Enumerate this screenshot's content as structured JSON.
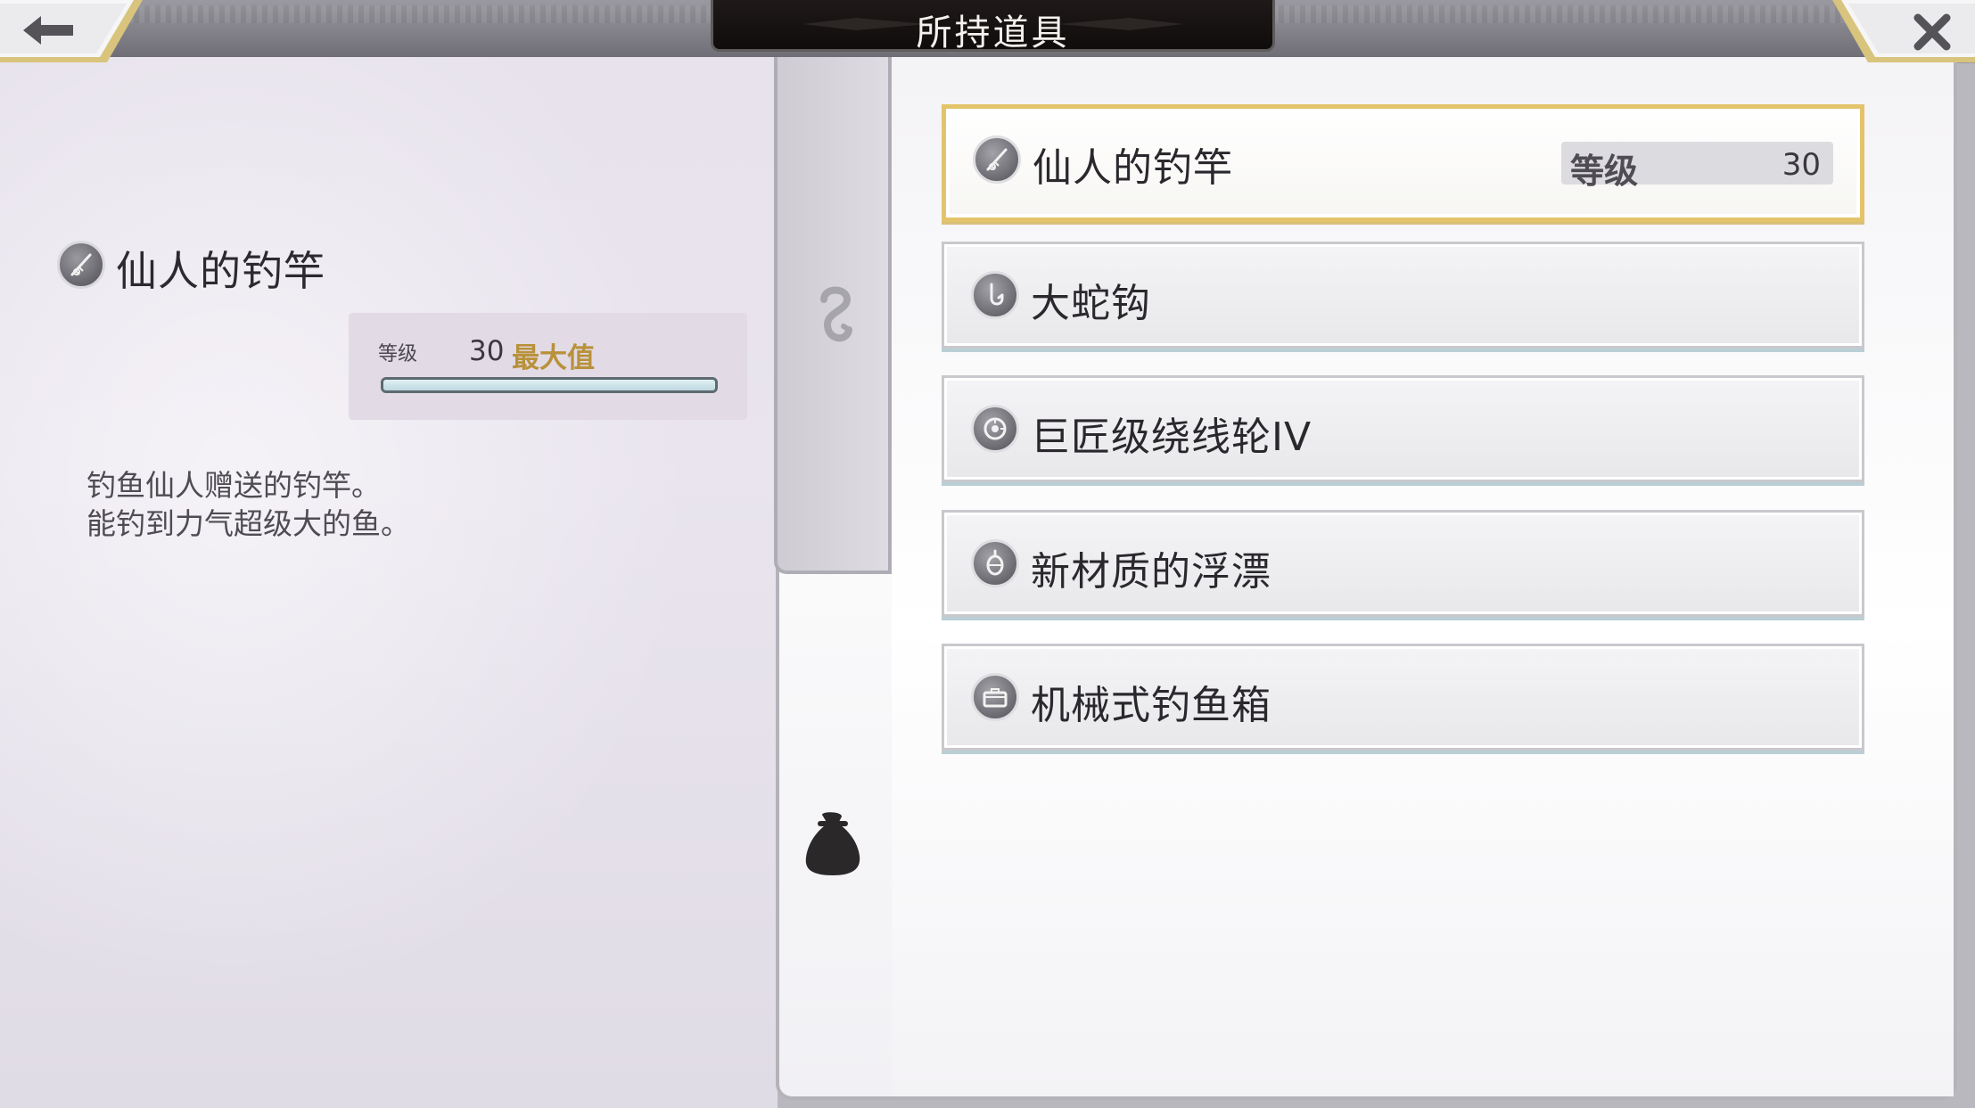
{
  "header": {
    "title": "所持道具",
    "back_icon": "back-arrow-icon",
    "close_icon": "close-icon"
  },
  "detail": {
    "icon": "fishing-rod-icon",
    "name": "仙人的钓竿",
    "level_label": "等级",
    "level_value": "30",
    "level_max_label": "最大值",
    "level_progress": 1.0,
    "description_lines": [
      "钓鱼仙人赠送的钓竿。",
      "能钓到力气超级大的鱼。"
    ]
  },
  "tabs": {
    "tackle_icon": "hook-icon",
    "items_icon": "bag-icon"
  },
  "items": [
    {
      "name": "仙人的钓竿",
      "icon": "fishing-rod-icon",
      "selected": true,
      "level_label": "等级",
      "level_value": "30"
    },
    {
      "name": "大蛇钩",
      "icon": "hook-icon",
      "selected": false
    },
    {
      "name": "巨匠级绕线轮IV",
      "icon": "reel-icon",
      "selected": false
    },
    {
      "name": "新材质的浮漂",
      "icon": "float-icon",
      "selected": false
    },
    {
      "name": "机械式钓鱼箱",
      "icon": "tackle-box-icon",
      "selected": false
    }
  ],
  "colors": {
    "accent_gold": "#e3c46b",
    "max_text": "#b8913a",
    "title_plate": "#1a1514"
  }
}
